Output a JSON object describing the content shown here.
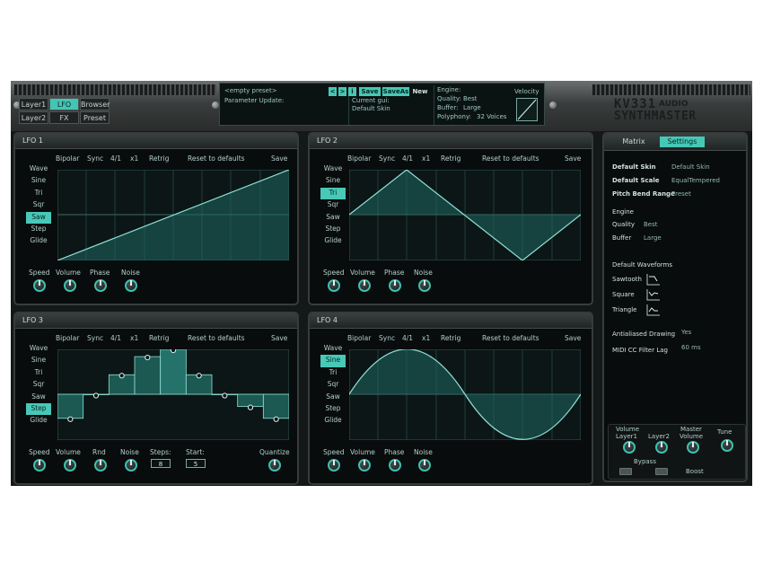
{
  "nav": {
    "layer1": "Layer1",
    "lfo": "LFO",
    "browser": "Browser",
    "layer2": "Layer2",
    "fx": "FX",
    "preset": "Preset"
  },
  "lcd": {
    "preset_name": "<empty preset>",
    "btn_prev": "<",
    "btn_next": ">",
    "btn_info": "i",
    "btn_save": "Save",
    "btn_saveas": "SaveAs",
    "btn_new": "New",
    "parameter_update": "Parameter Update:",
    "current_gui_label": "Current gui:",
    "current_gui_value": "Default Skin",
    "engine_label": "Engine:",
    "quality_label": "Quality:",
    "quality_value": "Best",
    "buffer_label": "Buffer:",
    "buffer_value": "Large",
    "polyphony_label": "Polyphony:",
    "polyphony_value": "32 Voices",
    "velocity_label": "Velocity"
  },
  "logo": {
    "line1": "KV331",
    "audio": "AUDIO",
    "line2": "SYNTHMASTER"
  },
  "common": {
    "bipolar": "Bipolar",
    "sync": "Sync",
    "ratio": "4/1",
    "mult": "x1",
    "retrig": "Retrig",
    "reset": "Reset to defaults",
    "save": "Save",
    "wave": "Wave"
  },
  "waveforms": [
    "Sine",
    "Tri",
    "Sqr",
    "Saw",
    "Step",
    "Glide"
  ],
  "lfos": [
    {
      "title": "LFO 1",
      "selected": "Saw",
      "knobs": [
        "Speed",
        "Volume",
        "Phase",
        "Noise"
      ]
    },
    {
      "title": "LFO 2",
      "selected": "Tri",
      "knobs": [
        "Speed",
        "Volume",
        "Phase",
        "Noise"
      ]
    },
    {
      "title": "LFO 3",
      "selected": "Step",
      "knobs": [
        "Speed",
        "Volume",
        "Rnd",
        "Noise"
      ],
      "steps_label": "Steps:",
      "steps_value": "8",
      "start_label": "Start:",
      "start_value": "5",
      "quantize": "Quantize",
      "step_levels": [
        0.24,
        0.5,
        0.72,
        0.92,
        1.0,
        0.72,
        0.5,
        0.37,
        0.24
      ]
    },
    {
      "title": "LFO 4",
      "selected": "Sine",
      "knobs": [
        "Speed",
        "Volume",
        "Phase",
        "Noise"
      ]
    }
  ],
  "settings": {
    "tab_matrix": "Matrix",
    "tab_settings": "Settings",
    "default_skin_label": "Default Skin",
    "default_skin_value": "Default Skin",
    "default_scale_label": "Default Scale",
    "default_scale_value": "EqualTempered",
    "pitch_bend_label": "Pitch Bend Range",
    "pitch_bend_value": "Preset",
    "engine_heading": "Engine",
    "quality_label": "Quality",
    "quality_value": "Best",
    "buffer_label": "Buffer",
    "buffer_value": "Large",
    "default_waveforms_heading": "Default Waveforms",
    "sawtooth_label": "Sawtooth",
    "square_label": "Square",
    "triangle_label": "Triangle",
    "antialiased_label": "Antialiased Drawing",
    "antialiased_value": "Yes",
    "midi_cc_label": "MIDI CC Filter Lag",
    "midi_cc_value": "60 ms"
  },
  "mixer": {
    "volume_heading": "Volume",
    "master_heading": "Master",
    "layer1": "Layer1",
    "layer2": "Layer2",
    "master_volume": "Volume",
    "tune": "Tune",
    "bypass": "Bypass",
    "boost": "Boost"
  },
  "colors": {
    "accent": "#46c8b6",
    "background": "#141818",
    "panel": "#080c0c"
  }
}
